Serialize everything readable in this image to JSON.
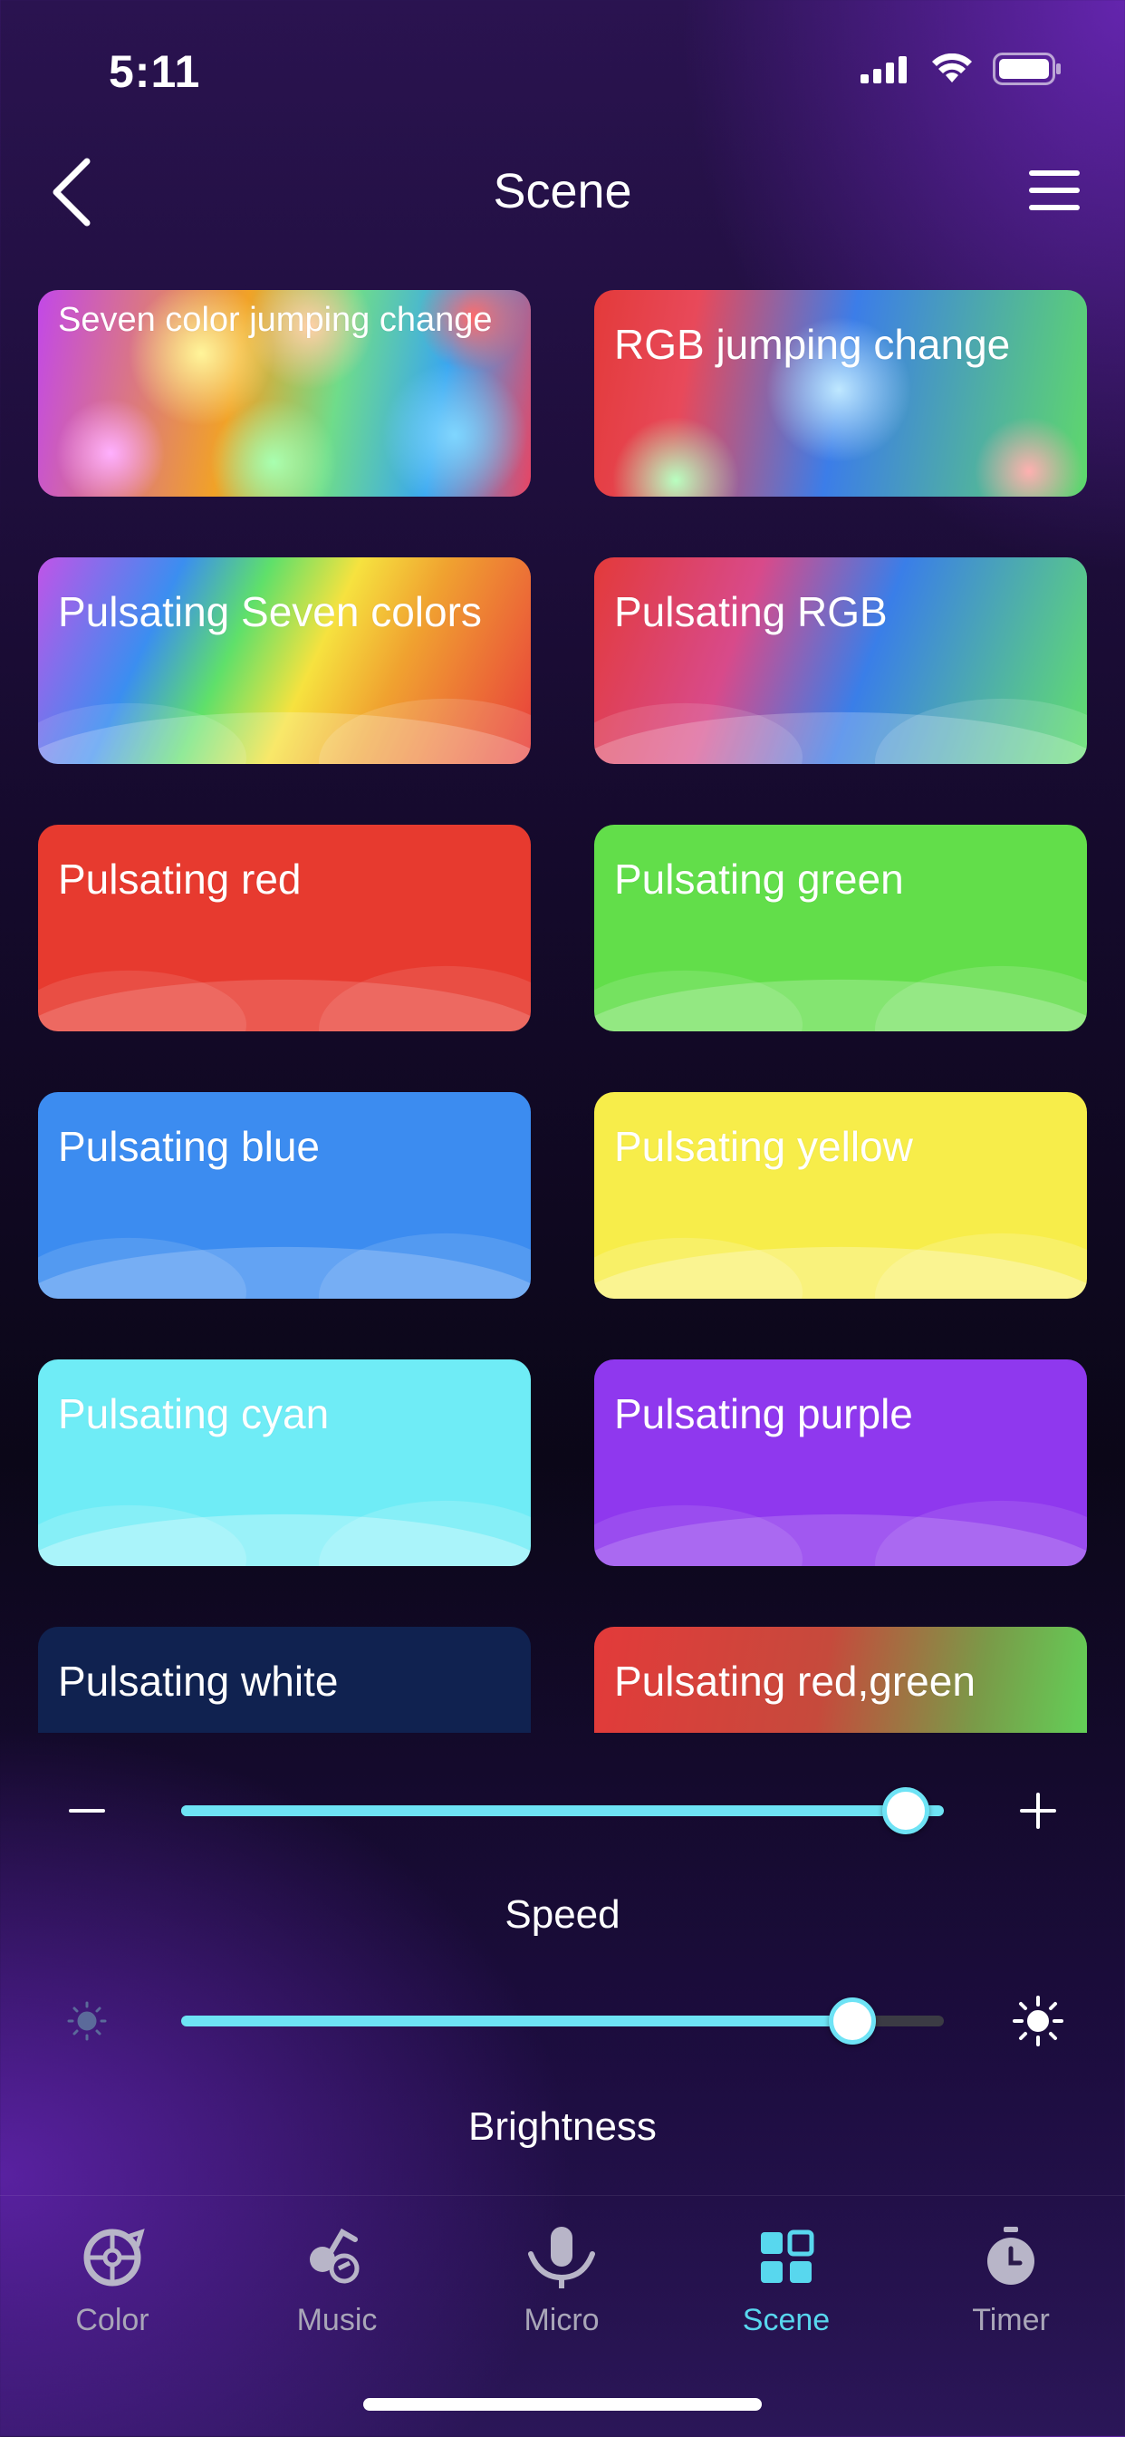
{
  "status": {
    "time": "5:11"
  },
  "header": {
    "title": "Scene"
  },
  "scenes": [
    {
      "label": "Seven color jumping change"
    },
    {
      "label": "RGB jumping change"
    },
    {
      "label": "Pulsating Seven colors"
    },
    {
      "label": "Pulsating RGB"
    },
    {
      "label": "Pulsating red"
    },
    {
      "label": "Pulsating green"
    },
    {
      "label": "Pulsating blue"
    },
    {
      "label": "Pulsating yellow"
    },
    {
      "label": "Pulsating cyan"
    },
    {
      "label": "Pulsating purple"
    },
    {
      "label": "Pulsating white"
    },
    {
      "label": "Pulsating red,green"
    }
  ],
  "speed": {
    "label": "Speed",
    "value_fraction": 0.95
  },
  "brightness": {
    "label": "Brightness",
    "value_fraction": 0.88
  },
  "tabs": [
    {
      "label": "Color",
      "icon": "color-wheel-icon"
    },
    {
      "label": "Music",
      "icon": "music-icon"
    },
    {
      "label": "Micro",
      "icon": "microphone-icon"
    },
    {
      "label": "Scene",
      "icon": "scene-grid-icon",
      "active": true
    },
    {
      "label": "Timer",
      "icon": "timer-icon"
    }
  ],
  "colors": {
    "accent": "#58d7ee",
    "slider": "#6ee3f5"
  }
}
